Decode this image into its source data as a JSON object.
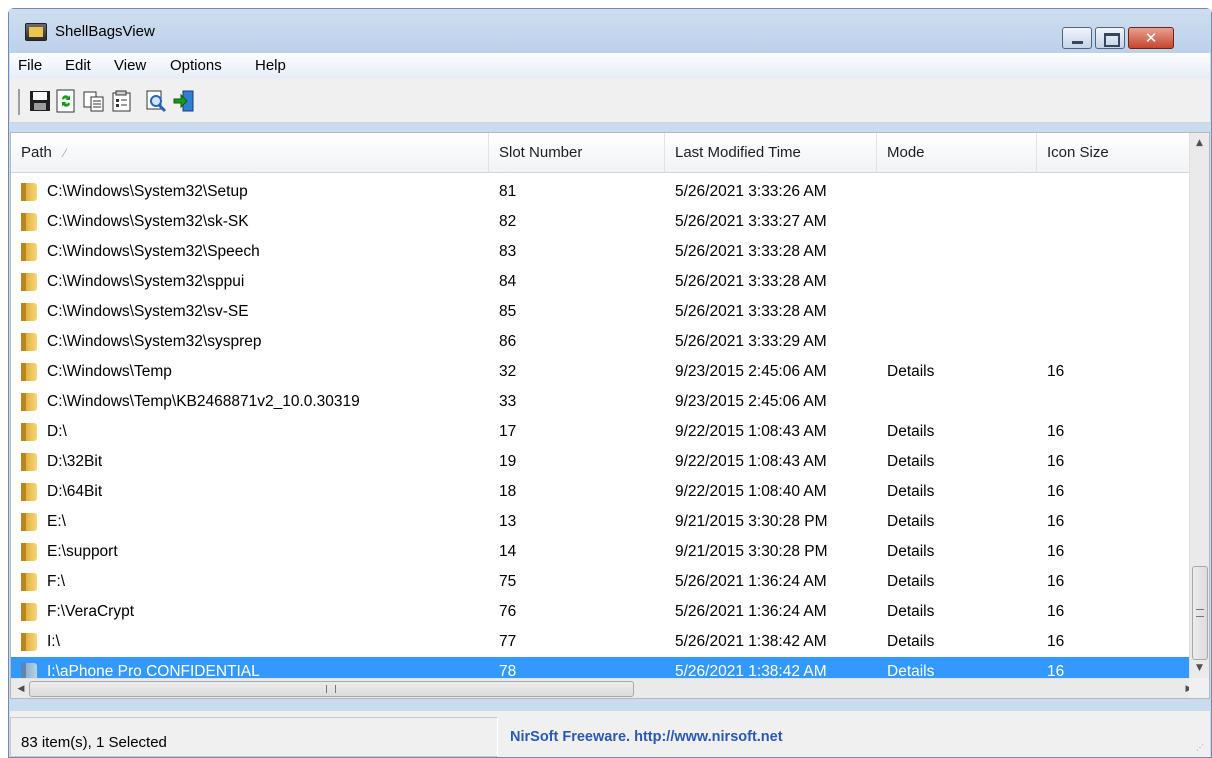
{
  "window": {
    "title": "ShellBagsView"
  },
  "menu": [
    "File",
    "Edit",
    "View",
    "Options",
    "Help"
  ],
  "toolbar": {
    "buttons": [
      {
        "name": "save-icon"
      },
      {
        "name": "refresh-icon"
      },
      {
        "name": "copy-icon"
      },
      {
        "name": "properties-icon"
      },
      {
        "name": "find-icon"
      },
      {
        "name": "exit-icon"
      }
    ]
  },
  "columns": [
    "Path",
    "Slot Number",
    "Last Modified Time",
    "Mode",
    "Icon Size"
  ],
  "rows": [
    {
      "path": "C:\\Windows\\System32\\Setup",
      "slot": "81",
      "time": "5/26/2021 3:33:26 AM",
      "mode": "",
      "icon": ""
    },
    {
      "path": "C:\\Windows\\System32\\sk-SK",
      "slot": "82",
      "time": "5/26/2021 3:33:27 AM",
      "mode": "",
      "icon": ""
    },
    {
      "path": "C:\\Windows\\System32\\Speech",
      "slot": "83",
      "time": "5/26/2021 3:33:28 AM",
      "mode": "",
      "icon": ""
    },
    {
      "path": "C:\\Windows\\System32\\sppui",
      "slot": "84",
      "time": "5/26/2021 3:33:28 AM",
      "mode": "",
      "icon": ""
    },
    {
      "path": "C:\\Windows\\System32\\sv-SE",
      "slot": "85",
      "time": "5/26/2021 3:33:28 AM",
      "mode": "",
      "icon": ""
    },
    {
      "path": "C:\\Windows\\System32\\sysprep",
      "slot": "86",
      "time": "5/26/2021 3:33:29 AM",
      "mode": "",
      "icon": ""
    },
    {
      "path": "C:\\Windows\\Temp",
      "slot": "32",
      "time": "9/23/2015 2:45:06 AM",
      "mode": "Details",
      "icon": "16"
    },
    {
      "path": "C:\\Windows\\Temp\\KB2468871v2_10.0.30319",
      "slot": "33",
      "time": "9/23/2015 2:45:06 AM",
      "mode": "",
      "icon": ""
    },
    {
      "path": "D:\\",
      "slot": "17",
      "time": "9/22/2015 1:08:43 AM",
      "mode": "Details",
      "icon": "16"
    },
    {
      "path": "D:\\32Bit",
      "slot": "19",
      "time": "9/22/2015 1:08:43 AM",
      "mode": "Details",
      "icon": "16"
    },
    {
      "path": "D:\\64Bit",
      "slot": "18",
      "time": "9/22/2015 1:08:40 AM",
      "mode": "Details",
      "icon": "16"
    },
    {
      "path": "E:\\",
      "slot": "13",
      "time": "9/21/2015 3:30:28 PM",
      "mode": "Details",
      "icon": "16"
    },
    {
      "path": "E:\\support",
      "slot": "14",
      "time": "9/21/2015 3:30:28 PM",
      "mode": "Details",
      "icon": "16"
    },
    {
      "path": "F:\\",
      "slot": "75",
      "time": "5/26/2021 1:36:24 AM",
      "mode": "Details",
      "icon": "16"
    },
    {
      "path": "F:\\VeraCrypt",
      "slot": "76",
      "time": "5/26/2021 1:36:24 AM",
      "mode": "Details",
      "icon": "16"
    },
    {
      "path": "I:\\",
      "slot": "77",
      "time": "5/26/2021 1:38:42 AM",
      "mode": "Details",
      "icon": "16"
    },
    {
      "path": "I:\\aPhone Pro CONFIDENTIAL",
      "slot": "78",
      "time": "5/26/2021 1:38:42 AM",
      "mode": "Details",
      "icon": "16",
      "selected": true
    }
  ],
  "status": {
    "items": "83 item(s), 1 Selected",
    "credit": "NirSoft Freeware.  http://www.nirsoft.net"
  },
  "scrollbar": {
    "hthumb_glyph": "III"
  }
}
